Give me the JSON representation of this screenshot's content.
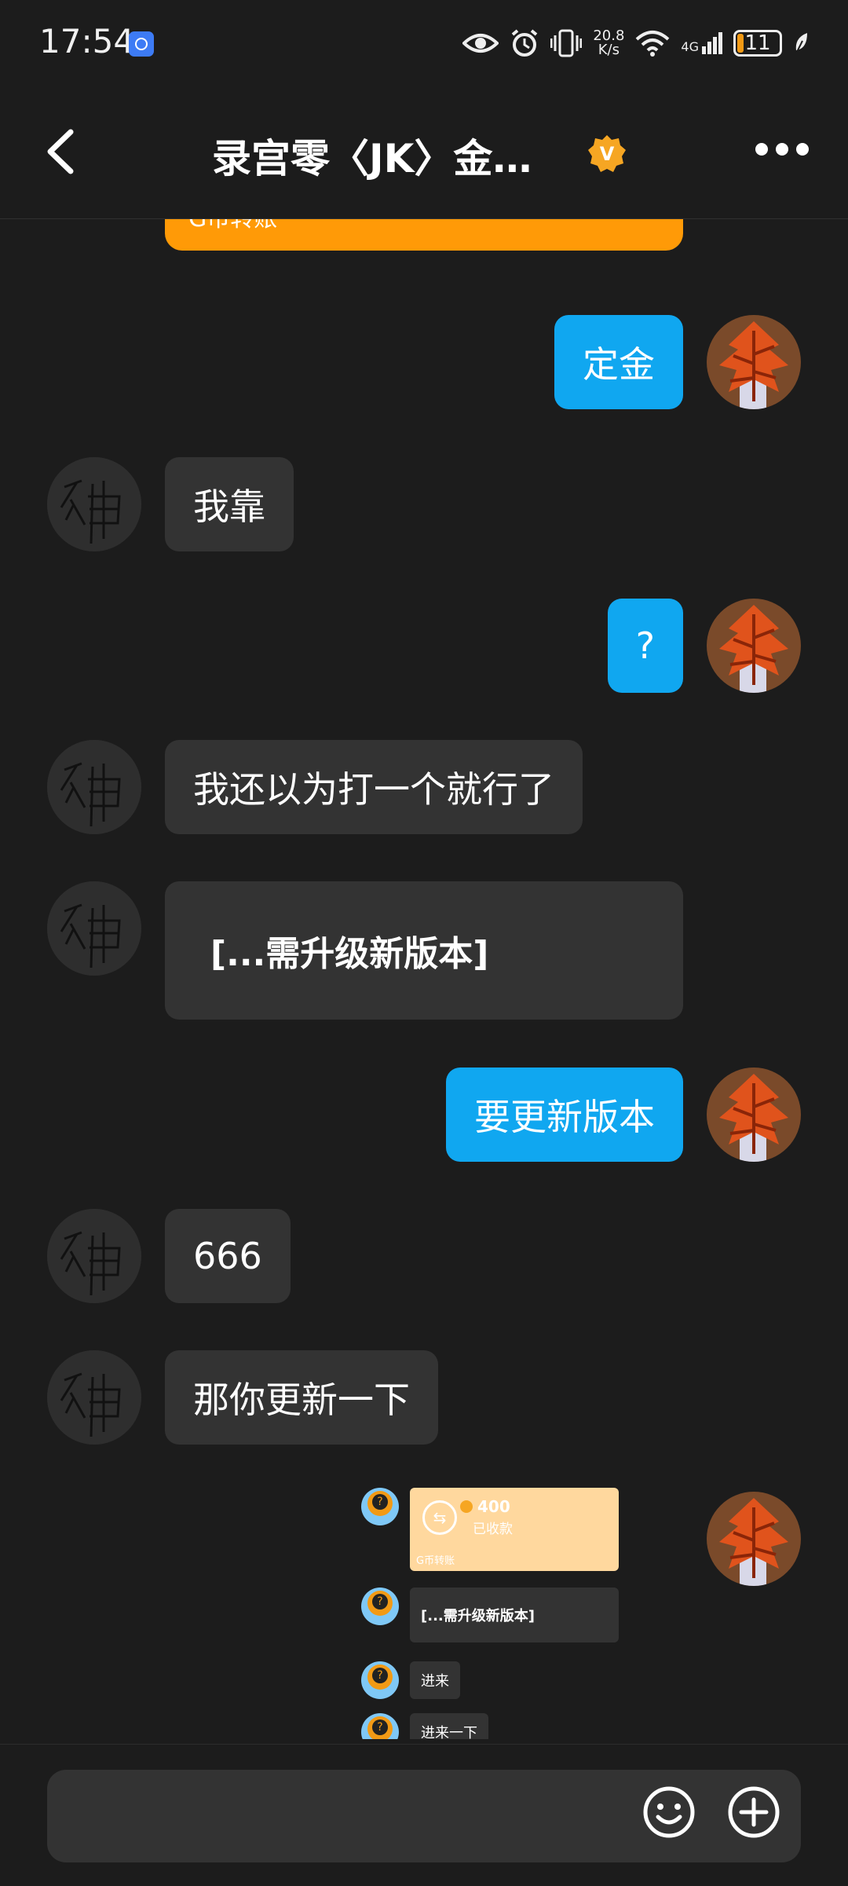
{
  "status_bar": {
    "time": "17:54",
    "net_speed_value": "20.8",
    "net_speed_unit": "K/s",
    "network": "4G",
    "battery": "11"
  },
  "header": {
    "title": "录宫零〈JK〉金…",
    "badge": "V"
  },
  "messages": [
    {
      "side": "them",
      "type": "card",
      "text": "G币转账"
    },
    {
      "side": "me",
      "text": "定金"
    },
    {
      "side": "them",
      "text": "我靠"
    },
    {
      "side": "me",
      "text": "?"
    },
    {
      "side": "them",
      "text": "我还以为打一个就行了"
    },
    {
      "side": "them",
      "text": "[...需升级新版本]"
    },
    {
      "side": "me",
      "text": "要更新版本"
    },
    {
      "side": "them",
      "text": "666"
    },
    {
      "side": "them",
      "text": "那你更新一下"
    }
  ],
  "forwarded": {
    "transfer_amount": "400",
    "transfer_status": "已收款",
    "transfer_label": "G币转账",
    "msg1": "[...需升级新版本]",
    "msg2": "进来",
    "msg3": "进来一下"
  },
  "colors": {
    "background": "#1c1c1c",
    "bubble_them": "#333333",
    "bubble_me": "#10a7f0",
    "accent_orange": "#ff9a07",
    "badge": "#f6a623"
  }
}
